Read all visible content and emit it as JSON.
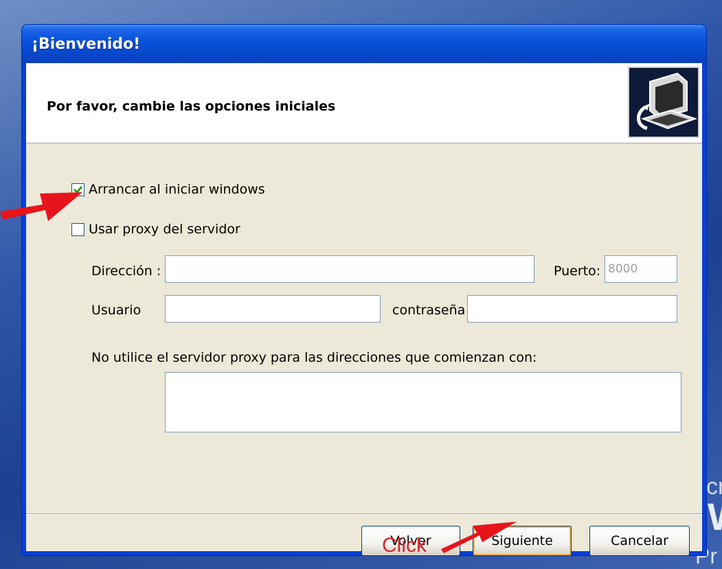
{
  "window": {
    "title": "¡Bienvenido!",
    "header_title": "Por favor, cambie las opciones iniciales"
  },
  "options": {
    "startup": {
      "label": "Arrancar al iniciar windows",
      "checked": true
    },
    "proxy": {
      "label": "Usar proxy del servidor",
      "checked": false
    }
  },
  "fields": {
    "direccion_label": "Dirección :",
    "direccion_value": "",
    "puerto_label": "Puerto:",
    "puerto_value": "8000",
    "usuario_label": "Usuario",
    "usuario_value": "",
    "contrasena_label": "contraseña",
    "contrasena_value": "",
    "exceptions_label": "No utilice el servidor proxy para las direcciones que comienzan con:",
    "exceptions_value": ""
  },
  "buttons": {
    "back": "Volver",
    "next": "Siguiente",
    "cancel": "Cancelar"
  },
  "annotation": {
    "click_text": "Click",
    "arrow_color": "#e8141c"
  },
  "desktop": {
    "text_1": "cr",
    "text_2": "W",
    "text_3": "Pr"
  }
}
